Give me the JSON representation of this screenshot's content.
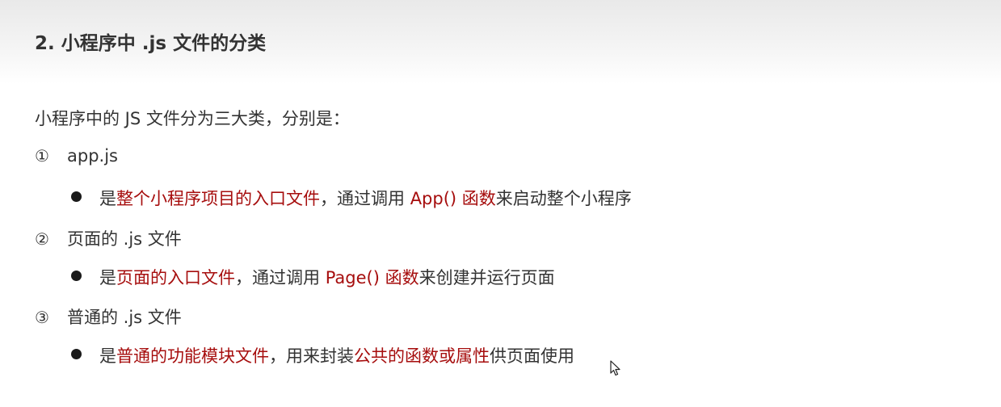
{
  "section": {
    "title": "2. 小程序中 .js 文件的分类"
  },
  "intro": "小程序中的 JS 文件分为三大类，分别是：",
  "items": [
    {
      "number": "①",
      "name": "app.js",
      "desc": [
        {
          "text": "是",
          "highlight": false
        },
        {
          "text": "整个小程序项目的入口文件",
          "highlight": true
        },
        {
          "text": "，通过调用 ",
          "highlight": false
        },
        {
          "text": "App() 函数",
          "highlight": true
        },
        {
          "text": "来启动整个小程序",
          "highlight": false
        }
      ]
    },
    {
      "number": "②",
      "name": "页面的 .js 文件",
      "desc": [
        {
          "text": "是",
          "highlight": false
        },
        {
          "text": "页面的入口文件",
          "highlight": true
        },
        {
          "text": "，通过调用 ",
          "highlight": false
        },
        {
          "text": "Page() 函数",
          "highlight": true
        },
        {
          "text": "来创建并运行页面",
          "highlight": false
        }
      ]
    },
    {
      "number": "③",
      "name": "普通的 .js 文件",
      "desc": [
        {
          "text": "是",
          "highlight": false
        },
        {
          "text": "普通的功能模块文件",
          "highlight": true
        },
        {
          "text": "，用来封装",
          "highlight": false
        },
        {
          "text": "公共的函数或属性",
          "highlight": true
        },
        {
          "text": "供页面使用",
          "highlight": false
        }
      ]
    }
  ],
  "colors": {
    "highlight": "#a60d0d",
    "text": "#333333"
  },
  "icons": {
    "cursor": "mouse-pointer-icon"
  }
}
